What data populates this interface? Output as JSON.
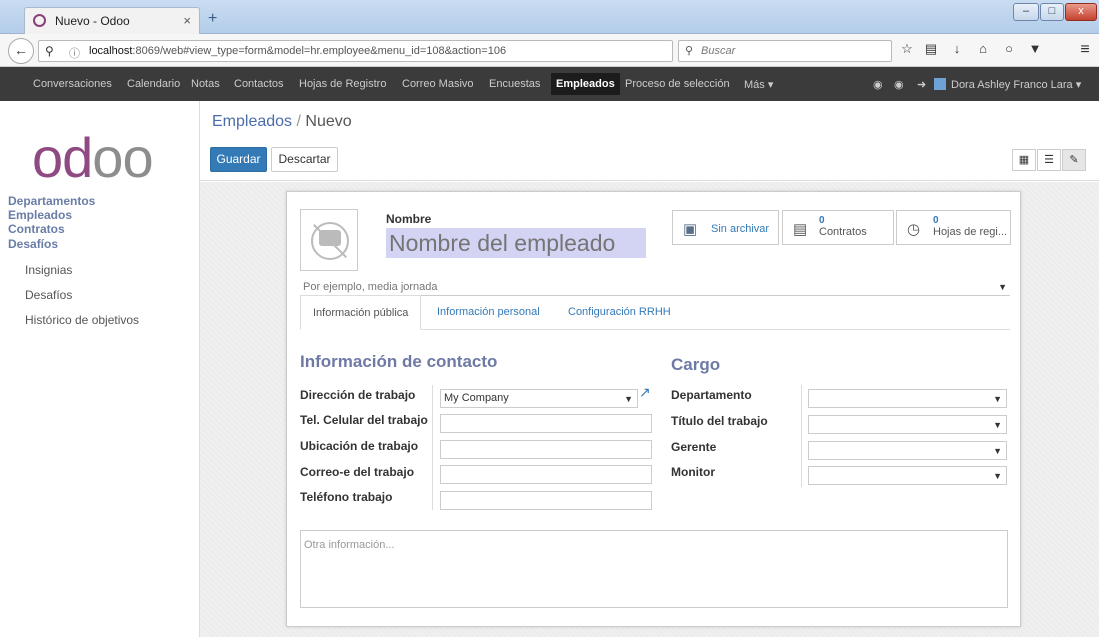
{
  "browser": {
    "tab_title": "Nuevo - Odoo",
    "tab_close": "×",
    "new_tab": "+",
    "url_host": "localhost",
    "url_rest": ":8069/web#view_type=form&model=hr.employee&menu_id=108&action=106",
    "search_placeholder": "Buscar",
    "win_min": "–",
    "win_max": "□",
    "win_close": "x"
  },
  "topmenu": {
    "items": [
      "Conversaciones",
      "Calendario",
      "Notas",
      "Contactos",
      "Hojas de Registro",
      "Correo Masivo",
      "Encuestas",
      "Empleados",
      "Proceso de selección",
      "Más ▾"
    ],
    "active": "Empleados",
    "user": "Dora Ashley Franco Lara ▾"
  },
  "sidebar": {
    "logo_main": "odoo",
    "headers": [
      "Departamentos",
      "Empleados",
      "Contratos",
      "Desafíos"
    ],
    "items": [
      "Insignias",
      "Desafíos",
      "Histórico de objetivos"
    ]
  },
  "control_panel": {
    "breadcrumb_parent": "Empleados",
    "breadcrumb_sep": "/",
    "breadcrumb_current": "Nuevo",
    "save_label": "Guardar",
    "discard_label": "Descartar"
  },
  "form": {
    "name_label": "Nombre",
    "name_placeholder": "Nombre del empleado",
    "smart_buttons": {
      "archive_label": "Sin archivar",
      "contracts_count": "0",
      "contracts_label": "Contratos",
      "timesheets_count": "0",
      "timesheets_label": "Hojas de regi..."
    },
    "job_placeholder": "Por ejemplo, media jornada",
    "tabs": [
      "Información pública",
      "Información personal",
      "Configuración RRHH"
    ],
    "active_tab": "Información pública",
    "contact_section": "Información de contacto",
    "contact_fields": {
      "work_address_label": "Dirección de trabajo",
      "work_address_value": "My Company",
      "mobile_label": "Tel. Celular del trabajo",
      "location_label": "Ubicación de trabajo",
      "email_label": "Correo-e del trabajo",
      "phone_label": "Teléfono trabajo"
    },
    "position_section": "Cargo",
    "position_fields": {
      "department_label": "Departamento",
      "job_title_label": "Título del trabajo",
      "manager_label": "Gerente",
      "coach_label": "Monitor"
    },
    "notes_placeholder": "Otra información..."
  },
  "colors": {
    "topbar": "#3b3b3b",
    "accent": "#337ab7",
    "logo": "#8f4a83",
    "name_input_bg": "#d3d3f4"
  }
}
